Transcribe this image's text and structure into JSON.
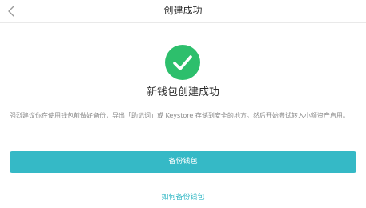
{
  "header": {
    "title": "创建成功",
    "back_icon": "chevron-left-icon"
  },
  "result": {
    "icon": "check-circle-icon",
    "accent_color": "#2dbf6c",
    "headline": "新钱包创建成功",
    "notice": "强烈建议你在使用钱包前做好备份，导出「助记词」或 Keystore 存储到安全的地方。然后开始尝试转入小额资产启用。"
  },
  "actions": {
    "backup_label": "备份钱包",
    "backup_color": "#35b9c6",
    "how_to_backup_label": "如何备份钱包"
  }
}
